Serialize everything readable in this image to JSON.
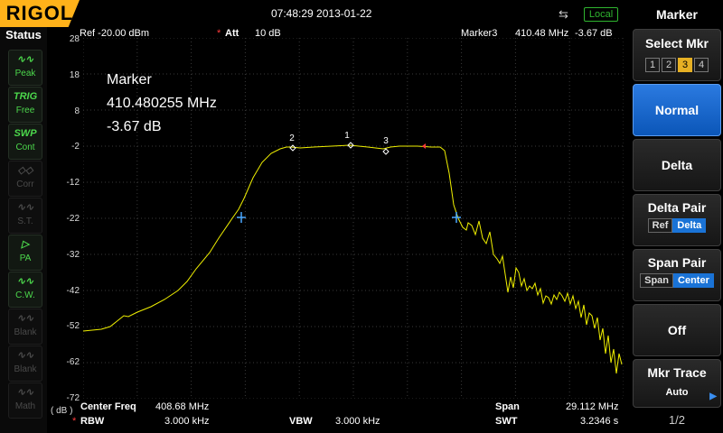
{
  "topbar": {
    "brand": "RIGOL",
    "datetime": "07:48:29 2013-01-22",
    "usb_icon": "usb-icon",
    "mode_badge": "Local"
  },
  "status": {
    "title": "Status",
    "items": [
      {
        "icon": "waveform-icon",
        "label": "Peak",
        "state": "on",
        "glyph": "∿∿"
      },
      {
        "icon": "trig-icon",
        "label": "Free",
        "state": "on",
        "glyph": "TRIG"
      },
      {
        "icon": "swp-icon",
        "label": "Cont",
        "state": "on",
        "glyph": "SWP"
      },
      {
        "icon": "corr-icon",
        "label": "Corr",
        "state": "off",
        "glyph": "◇◇"
      },
      {
        "icon": "st-icon",
        "label": "S.T.",
        "state": "off",
        "glyph": "∿∿"
      },
      {
        "icon": "pa-icon",
        "label": "PA",
        "state": "on",
        "glyph": "▷"
      },
      {
        "icon": "cw-icon",
        "label": "C.W.",
        "state": "on",
        "glyph": "∿∿"
      },
      {
        "icon": "blank-icon",
        "label": "Blank",
        "state": "off",
        "glyph": "∿∿"
      },
      {
        "icon": "blank-icon",
        "label": "Blank",
        "state": "off",
        "glyph": "∿∿"
      },
      {
        "icon": "math-icon",
        "label": "Math",
        "state": "off",
        "glyph": "∿∿"
      }
    ]
  },
  "header": {
    "ref": "Ref -20.00 dBm",
    "att_label": "Att",
    "att_value": "10 dB",
    "marker_name": "Marker3",
    "marker_freq": "410.48 MHz",
    "marker_level": "-3.67 dB"
  },
  "marker_readout": {
    "title": "Marker",
    "freq": "410.480255 MHz",
    "level": "-3.67 dB"
  },
  "axis": {
    "y_ticks": [
      "28",
      "18",
      "8",
      "-2",
      "-12",
      "-22",
      "-32",
      "-42",
      "-52",
      "-62",
      "-72"
    ],
    "unit": "( dB )"
  },
  "footer": {
    "center_label": "Center Freq",
    "center_value": "408.68 MHz",
    "span_label": "Span",
    "span_value": "29.112 MHz",
    "rbw_label": "RBW",
    "rbw_value": "3.000 kHz",
    "vbw_label": "VBW",
    "vbw_value": "3.000 kHz",
    "swt_label": "SWT",
    "swt_value": "3.2346 s"
  },
  "menu": {
    "title": "Marker",
    "select_label": "Select Mkr",
    "mkrs": [
      "1",
      "2",
      "3",
      "4"
    ],
    "selected_mkr": "3",
    "normal": "Normal",
    "delta": "Delta",
    "delta_pair": "Delta Pair",
    "delta_pair_opts": [
      "Ref",
      "Delta"
    ],
    "span_pair": "Span Pair",
    "span_pair_opts": [
      "Span",
      "Center"
    ],
    "off": "Off",
    "mkr_trace": "Mkr Trace",
    "mkr_trace_value": "Auto",
    "page": "1/2"
  },
  "markers": [
    {
      "label": "1"
    },
    {
      "label": "2"
    },
    {
      "label": "3"
    }
  ],
  "colors": {
    "trace": "#f0f000",
    "brand": "#ffb21a",
    "active": "#1a73d6",
    "status_on": "#4cd84c"
  }
}
